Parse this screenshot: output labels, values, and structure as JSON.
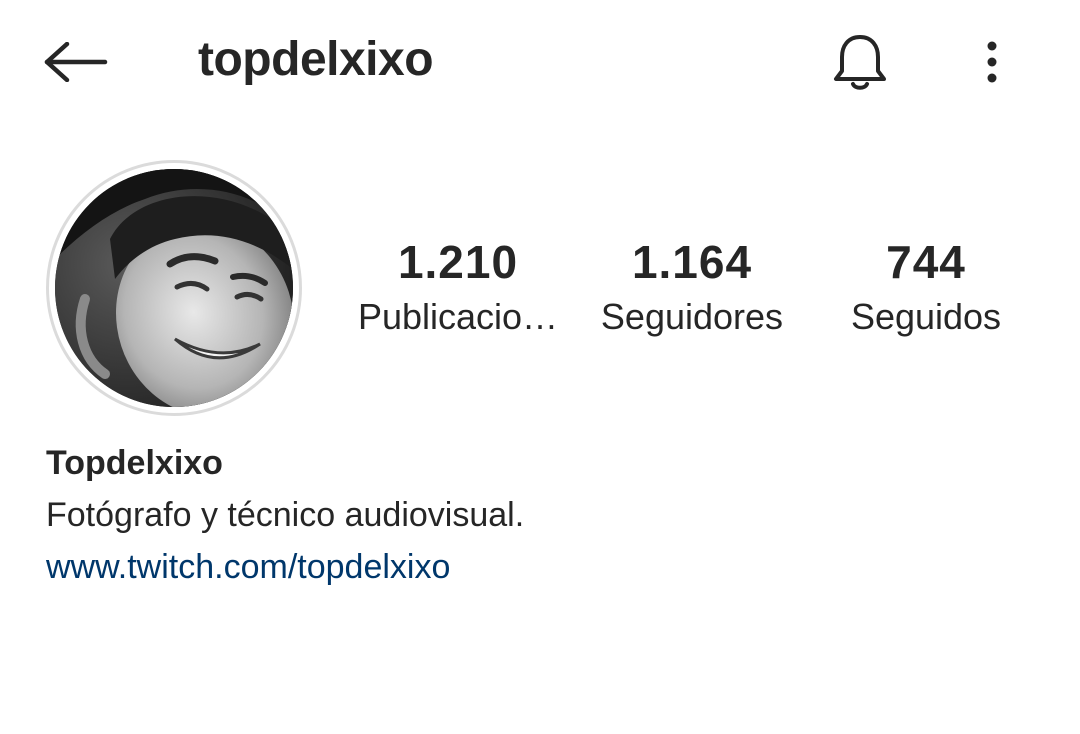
{
  "header": {
    "username": "topdelxixo",
    "back_icon": "arrow-left-icon",
    "bell_icon": "bell-icon",
    "more_icon": "more-vertical-icon"
  },
  "profile": {
    "avatar_icon": "profile-photo",
    "stats": {
      "posts_count": "1.210",
      "posts_label": "Publicacio…",
      "followers_count": "1.164",
      "followers_label": "Seguidores",
      "following_count": "744",
      "following_label": "Seguidos"
    },
    "display_name": "Topdelxixo",
    "bio": "Fotógrafo y técnico audiovisual.",
    "link": "www.twitch.com/topdelxixo"
  },
  "colors": {
    "text": "#262626",
    "link": "#00376b",
    "avatar_ring": "#dbdbdb",
    "background": "#ffffff"
  }
}
